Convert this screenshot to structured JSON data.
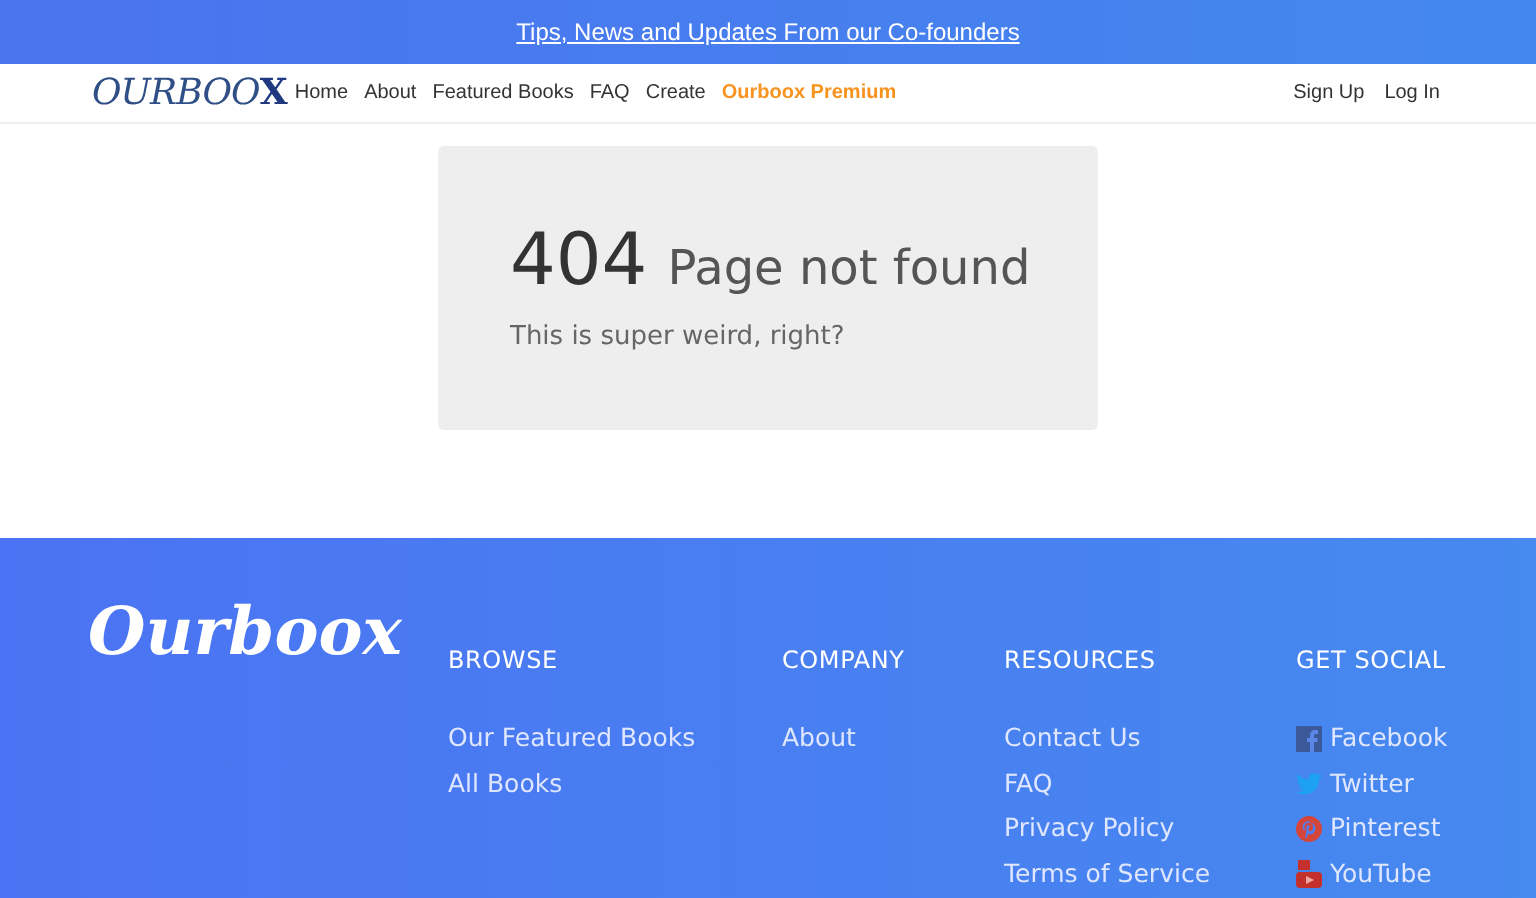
{
  "banner": {
    "link": "Tips, News and Updates From our Co-founders"
  },
  "nav": {
    "logo": {
      "main": "OURBOO",
      "accent": "X"
    },
    "links": [
      {
        "label": "Home",
        "kind": "plain"
      },
      {
        "label": "About",
        "kind": "plain"
      },
      {
        "label": "Featured Books",
        "kind": "plain"
      },
      {
        "label": "FAQ",
        "kind": "plain"
      },
      {
        "label": "Create",
        "kind": "plain"
      },
      {
        "label": "Ourboox Premium",
        "kind": "premium"
      }
    ],
    "account": [
      "Sign Up",
      "Log In"
    ]
  },
  "error": {
    "code": "404",
    "title": "Page not found",
    "message": "This is super weird, right?"
  },
  "footer": {
    "logo": "Ourboox",
    "columns": [
      {
        "heading": "BROWSE",
        "links": [
          {
            "label": "Our Featured Books"
          },
          {
            "label": "All Books"
          }
        ]
      },
      {
        "heading": "COMPANY",
        "links": [
          {
            "label": "About"
          }
        ]
      },
      {
        "heading": "RESOURCES",
        "links": [
          {
            "label": "Contact Us"
          },
          {
            "label": "FAQ"
          },
          {
            "label": "Privacy Policy"
          },
          {
            "label": "Terms of Service"
          }
        ]
      },
      {
        "heading": "GET SOCIAL",
        "links": [
          {
            "label": "Facebook",
            "kind": "facebook"
          },
          {
            "label": "Twitter",
            "kind": "twitter"
          },
          {
            "label": "Pinterest",
            "kind": "pinterest"
          },
          {
            "label": "YouTube",
            "kind": "youtube"
          }
        ]
      }
    ]
  }
}
